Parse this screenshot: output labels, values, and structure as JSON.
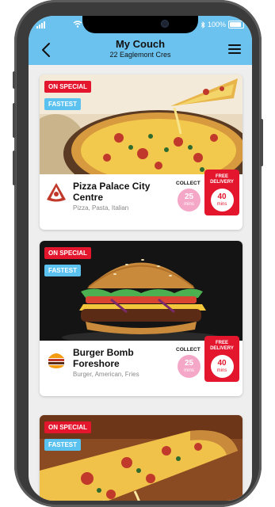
{
  "header": {
    "title": "My Couch",
    "subtitle": "22 Eaglemont Cres",
    "battery_text": "100%"
  },
  "restaurants": [
    {
      "name": "Pizza Palace City Centre",
      "tags": "Pizza, Pasta, Italian",
      "special_label": "ON SPECIAL",
      "fastest_label": "FASTEST",
      "collect_label": "COLLECT",
      "collect_time": "25",
      "collect_unit": "mins",
      "delivery_label": "FREE DELIVERY",
      "delivery_time": "40",
      "delivery_unit": "mins"
    },
    {
      "name": "Burger Bomb Foreshore",
      "tags": "Burger, American, Fries",
      "special_label": "ON SPECIAL",
      "fastest_label": "FASTEST",
      "collect_label": "COLLECT",
      "collect_time": "25",
      "collect_unit": "mins",
      "delivery_label": "FREE DELIVERY",
      "delivery_time": "40",
      "delivery_unit": "mins"
    },
    {
      "special_label": "ON SPECIAL",
      "fastest_label": "FASTEST"
    }
  ],
  "colors": {
    "header_bg": "#6cc2ee",
    "special_badge": "#e3162d",
    "fastest_badge": "#5bc2f0",
    "collect_circle": "#f4a7c6",
    "delivery_box": "#e3162d"
  },
  "icons": {
    "back": "chevron-left-icon",
    "menu": "hamburger-menu-icon",
    "signal": "cellular-signal-icon",
    "wifi": "wifi-icon",
    "bluetooth": "bluetooth-icon",
    "battery": "battery-icon"
  }
}
